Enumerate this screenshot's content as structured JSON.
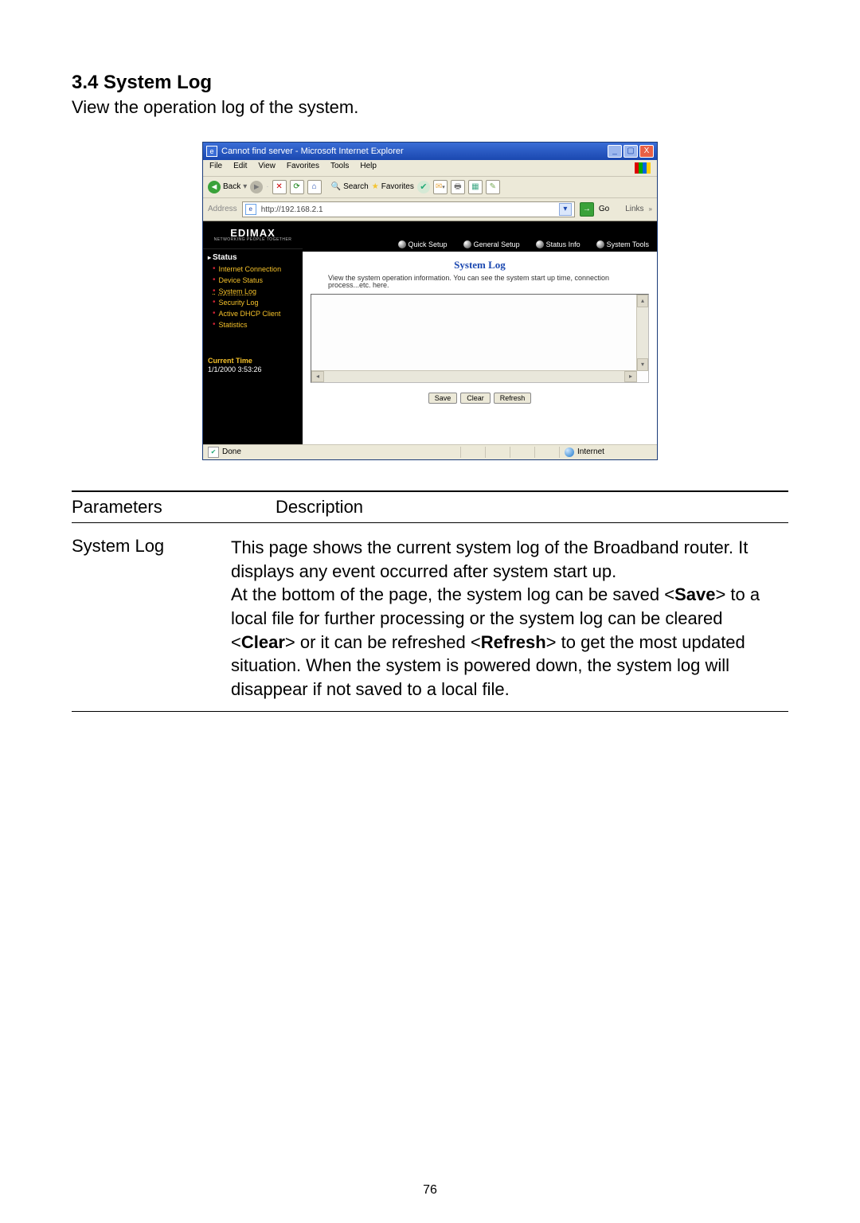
{
  "heading": "3.4 System Log",
  "intro": "View the operation log of the system.",
  "ie": {
    "title": "Cannot find server - Microsoft Internet Explorer",
    "menu": [
      "File",
      "Edit",
      "View",
      "Favorites",
      "Tools",
      "Help"
    ],
    "toolbar": {
      "back": "Back",
      "search": "Search",
      "favorites": "Favorites"
    },
    "address_label": "Address",
    "address_value": "http://192.168.2.1",
    "go": "Go",
    "links": "Links",
    "logo": "EDIMAX",
    "logo_tag": "NETWORKING PEOPLE TOGETHER",
    "banner": [
      "Quick Setup",
      "General Setup",
      "Status Info",
      "System Tools"
    ],
    "sidebar_section": "Status",
    "sidebar_items": [
      "Internet Connection",
      "Device Status",
      "System Log",
      "Security Log",
      "Active DHCP Client",
      "Statistics"
    ],
    "current_time_label": "Current Time",
    "current_time_value": "1/1/2000 3:53:26",
    "panel_title": "System Log",
    "panel_desc": "View the system operation information. You can see the system start up time, connection process...etc. here.",
    "buttons": {
      "save": "Save",
      "clear": "Clear",
      "refresh": "Refresh"
    },
    "status_done": "Done",
    "status_zone": "Internet"
  },
  "table": {
    "col_param": "Parameters",
    "col_desc": "Description",
    "row_name": "System Log",
    "row_desc_a": "This page shows the current system log of the Broadband router. It displays any event occurred after system start up.",
    "row_desc_b1": "At the bottom of the page, the system log can be saved <",
    "row_desc_b_save": "Save",
    "row_desc_b2": "> to a local file for further processing or the system log can be cleared <",
    "row_desc_b_clear": "Clear",
    "row_desc_b3": "> or it can be refreshed <",
    "row_desc_b_refresh": "Refresh",
    "row_desc_b4": "> to get the most updated situation. When the system is powered down, the system log will disappear if not saved to a local file."
  },
  "page_number": "76"
}
